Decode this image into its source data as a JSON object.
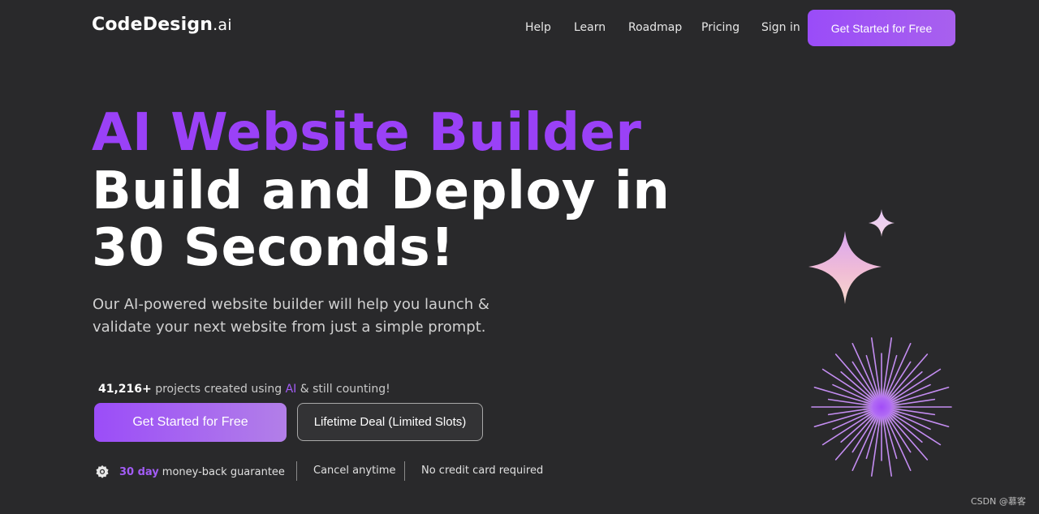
{
  "header": {
    "logo_main": "CodeDesign",
    "logo_suffix": ".ai",
    "nav": {
      "help": "Help",
      "learn": "Learn",
      "roadmap": "Roadmap",
      "pricing": "Pricing",
      "signin": "Sign in"
    },
    "cta_label": "Get Started for Free"
  },
  "hero": {
    "line1": "AI Website Builder",
    "line2": "Build and Deploy in",
    "line3": "30 Seconds!",
    "subtitle": "Our AI-powered website builder will help you launch & validate your next website from just a simple prompt."
  },
  "stats": {
    "count": "41,216+",
    "text_before": " projects created using ",
    "ai": "AI",
    "text_after": " & still counting!"
  },
  "actions": {
    "primary_label": "Get Started for Free",
    "secondary_label": "Lifetime Deal (Limited Slots)"
  },
  "guarantees": {
    "days": "30 day",
    "money_back": "money-back guarantee",
    "cancel": "Cancel anytime",
    "no_card": "No credit card required"
  },
  "watermark": "CSDN @慕客",
  "colors": {
    "background": "#29292b",
    "accent": "#9a41f7",
    "button_gradient_start": "#9b4df8",
    "button_gradient_end": "#b27fe8"
  },
  "icons": {
    "badge": "award-badge-icon",
    "sparkle": "sparkle-star-icon",
    "burst": "starburst-icon"
  }
}
